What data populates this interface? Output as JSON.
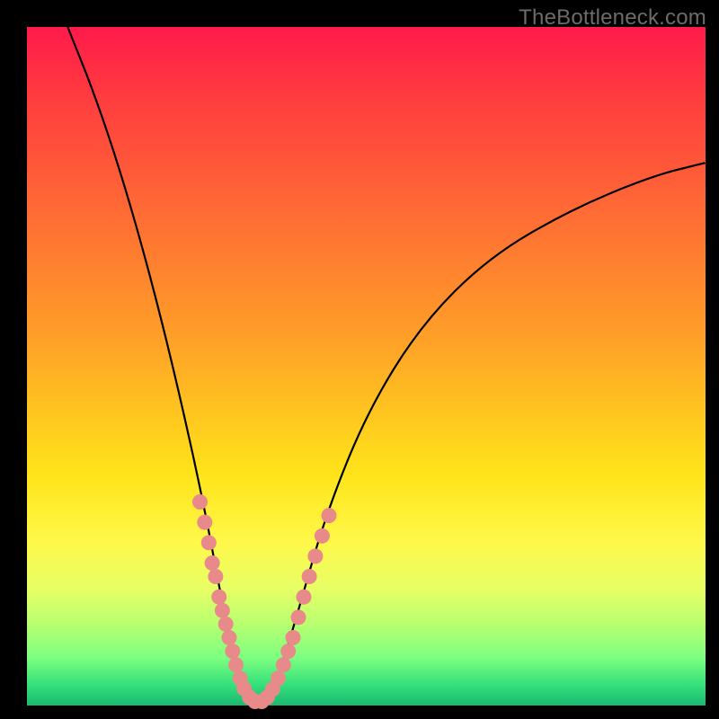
{
  "watermark": "TheBottleneck.com",
  "chart_data": {
    "type": "line",
    "title": "",
    "xlabel": "",
    "ylabel": "",
    "x_range": [
      0,
      100
    ],
    "y_range": [
      0,
      100
    ],
    "curve": {
      "description": "V-shaped bottleneck curve; minimum near x≈34; left branch starts at top-left and falls to minimum; right branch rises and asymptotically approaches ~y=80 at right edge",
      "points": [
        {
          "x": 6,
          "y": 100
        },
        {
          "x": 10,
          "y": 90
        },
        {
          "x": 14,
          "y": 78
        },
        {
          "x": 18,
          "y": 64
        },
        {
          "x": 22,
          "y": 48
        },
        {
          "x": 26,
          "y": 30
        },
        {
          "x": 29,
          "y": 14
        },
        {
          "x": 31,
          "y": 4
        },
        {
          "x": 33,
          "y": 0
        },
        {
          "x": 35,
          "y": 0
        },
        {
          "x": 37,
          "y": 4
        },
        {
          "x": 40,
          "y": 14
        },
        {
          "x": 44,
          "y": 28
        },
        {
          "x": 50,
          "y": 43
        },
        {
          "x": 58,
          "y": 56
        },
        {
          "x": 68,
          "y": 66
        },
        {
          "x": 80,
          "y": 73
        },
        {
          "x": 92,
          "y": 78
        },
        {
          "x": 100,
          "y": 80
        }
      ]
    },
    "scatter": {
      "description": "Pink/salmon dots clustered along both branches near the minimum (lower y region)",
      "points": [
        {
          "x": 25.5,
          "y": 30
        },
        {
          "x": 26.2,
          "y": 27
        },
        {
          "x": 26.8,
          "y": 24
        },
        {
          "x": 27.3,
          "y": 21
        },
        {
          "x": 27.8,
          "y": 19
        },
        {
          "x": 28.3,
          "y": 16
        },
        {
          "x": 28.8,
          "y": 14
        },
        {
          "x": 29.3,
          "y": 12
        },
        {
          "x": 29.8,
          "y": 10
        },
        {
          "x": 30.3,
          "y": 8
        },
        {
          "x": 30.8,
          "y": 6
        },
        {
          "x": 31.4,
          "y": 4
        },
        {
          "x": 32.0,
          "y": 2.5
        },
        {
          "x": 32.8,
          "y": 1.2
        },
        {
          "x": 33.6,
          "y": 0.6
        },
        {
          "x": 34.6,
          "y": 0.6
        },
        {
          "x": 35.4,
          "y": 1.2
        },
        {
          "x": 36.2,
          "y": 2.4
        },
        {
          "x": 37.0,
          "y": 4
        },
        {
          "x": 37.8,
          "y": 6
        },
        {
          "x": 38.5,
          "y": 8
        },
        {
          "x": 39.2,
          "y": 10
        },
        {
          "x": 40.0,
          "y": 13
        },
        {
          "x": 40.8,
          "y": 16
        },
        {
          "x": 41.6,
          "y": 19
        },
        {
          "x": 42.5,
          "y": 22
        },
        {
          "x": 43.5,
          "y": 25
        },
        {
          "x": 44.5,
          "y": 28
        }
      ]
    }
  },
  "colors": {
    "dot": "#e88a8a",
    "curve": "#000000",
    "watermark": "#6b6b6b"
  }
}
